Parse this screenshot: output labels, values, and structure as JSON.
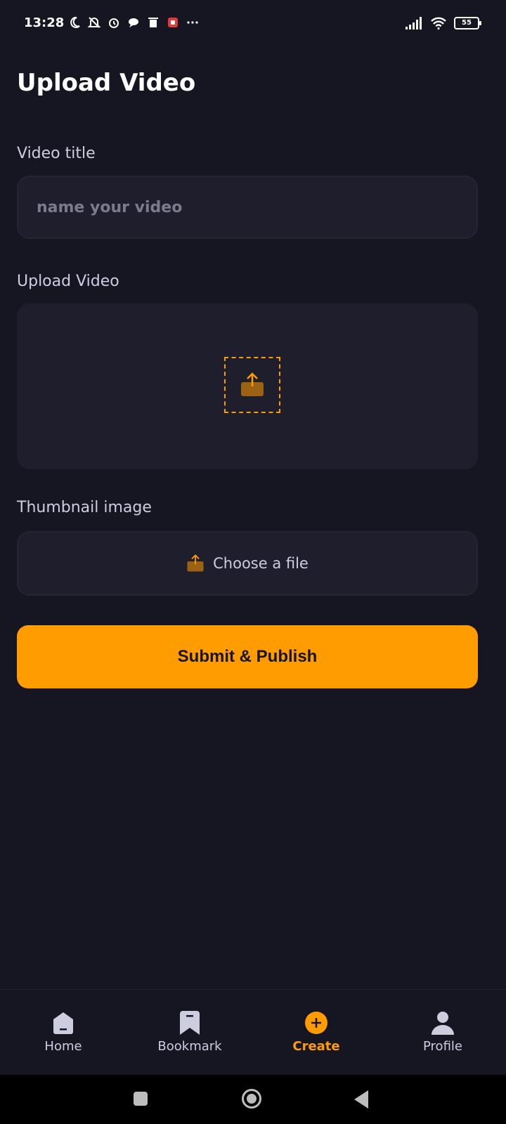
{
  "status_bar": {
    "time": "13:28",
    "battery": "55"
  },
  "page": {
    "title": "Upload Video",
    "video_title_label": "Video title",
    "video_title_placeholder": "name your video",
    "upload_video_label": "Upload Video",
    "thumbnail_label": "Thumbnail image",
    "choose_file_label": "Choose a file",
    "submit_label": "Submit & Publish"
  },
  "tabs": [
    {
      "label": "Home",
      "icon": "home-icon",
      "active": false
    },
    {
      "label": "Bookmark",
      "icon": "bookmark-icon",
      "active": false
    },
    {
      "label": "Create",
      "icon": "plus-icon",
      "active": true
    },
    {
      "label": "Profile",
      "icon": "profile-icon",
      "active": false
    }
  ],
  "colors": {
    "accent": "#ff9c01",
    "background": "#161622",
    "surface": "#1e1e2d",
    "text_muted": "#cdcde0"
  }
}
